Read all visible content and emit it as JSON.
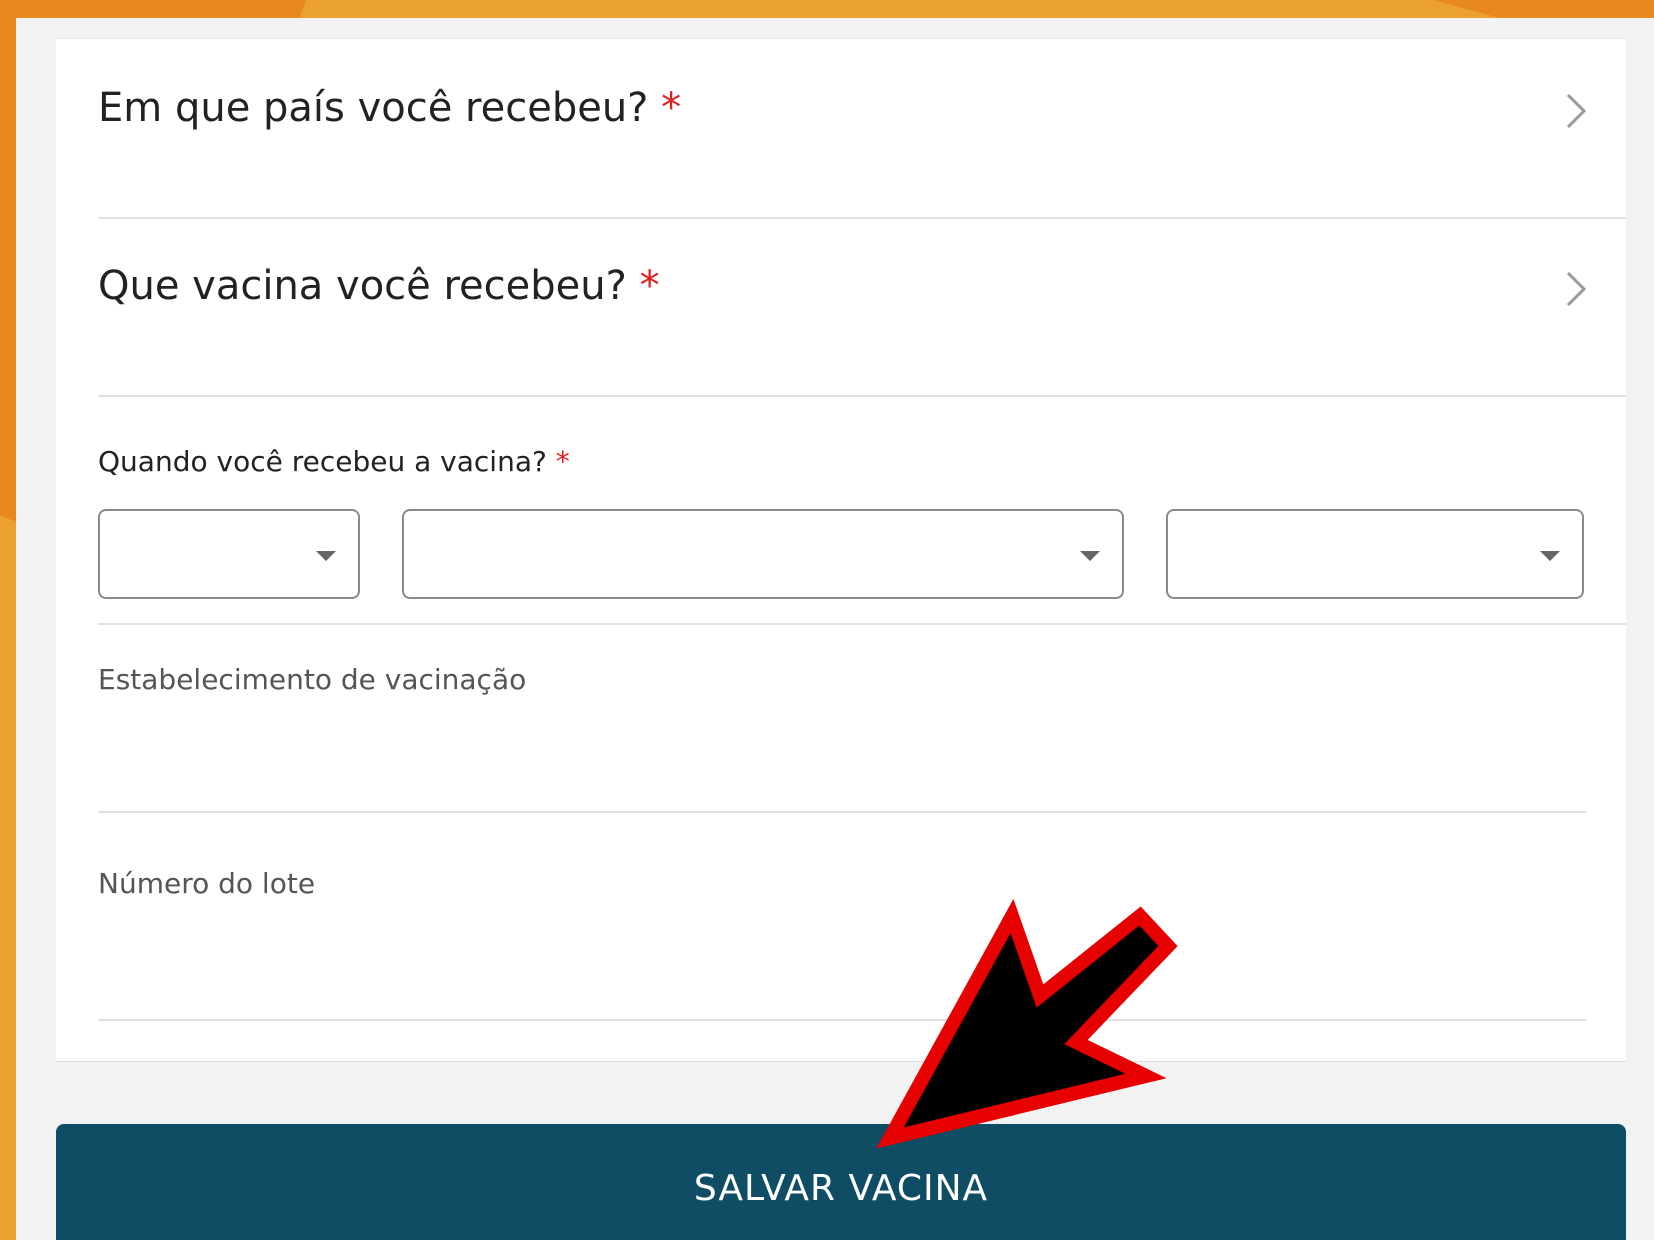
{
  "form": {
    "country_question": "Em que país você recebeu?",
    "vaccine_question": "Que vacina você recebeu?",
    "required_marker": "*",
    "date_question": "Quando você recebeu a vacina?",
    "date_day_value": "",
    "date_month_value": "",
    "date_year_value": "",
    "establishment_label": "Estabelecimento de vacinação",
    "establishment_value": "",
    "lot_label": "Número do lote",
    "lot_value": ""
  },
  "actions": {
    "save_label": "SALVAR VACINA"
  },
  "icons": {
    "row_chevron": "chevron-right-icon",
    "select_caret": "caret-down-icon",
    "annotation": "red-outlined-black-arrow-icon"
  },
  "colors": {
    "frame_orange": "#eba12f",
    "button_teal": "#0e4d63",
    "required_red": "#e02020",
    "arrow_red": "#e60000"
  }
}
